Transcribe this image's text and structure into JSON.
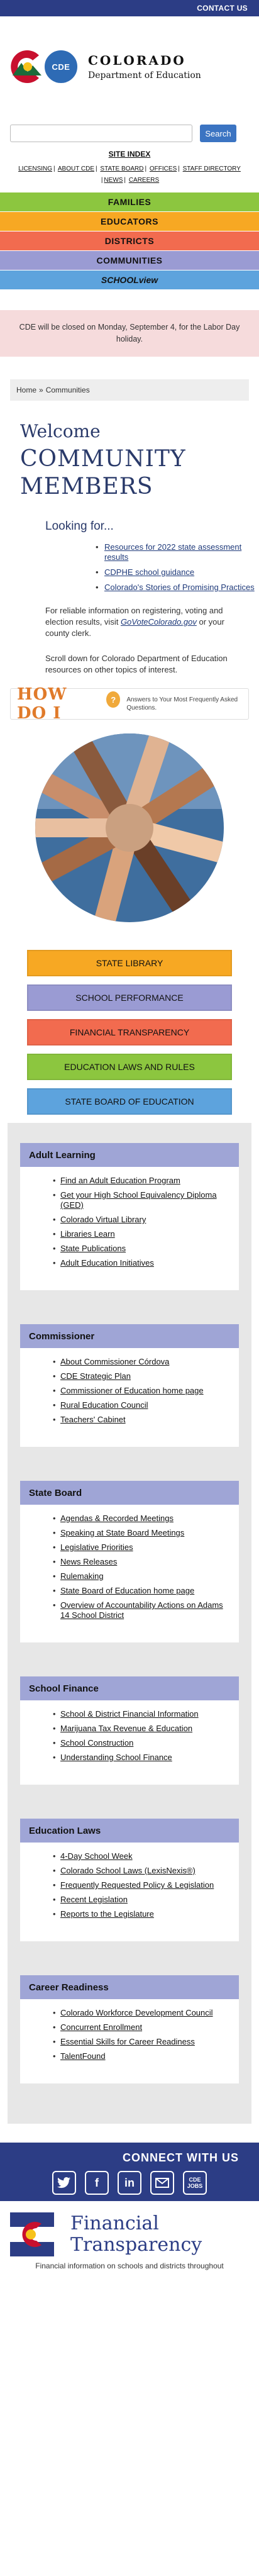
{
  "topbar": {
    "contact": "CONTACT US"
  },
  "brand": {
    "badge": "CDE",
    "name": "COLORADO",
    "sub": "Department of Education"
  },
  "search": {
    "placeholder": "",
    "button": "Search"
  },
  "site_index": "SITE INDEX",
  "utility_links": [
    "LICENSING",
    "ABOUT CDE",
    "STATE BOARD",
    "OFFICES",
    "STAFF DIRECTORY",
    "NEWS",
    "CAREERS"
  ],
  "nav": [
    {
      "label": "FAMILIES",
      "color": "#8cc63f"
    },
    {
      "label": "EDUCATORS",
      "color": "#f7a823"
    },
    {
      "label": "DISTRICTS",
      "color": "#f26b4f"
    },
    {
      "label": "COMMUNITIES",
      "color": "#9a9bd3"
    },
    {
      "label": "SCHOOLview",
      "color": "#5da3dd"
    }
  ],
  "alert": "CDE will be closed on Monday, September 4, for the Labor Day holiday.",
  "breadcrumb": {
    "home": "Home",
    "sep": "»",
    "current": "Communities"
  },
  "welcome": {
    "line1": "Welcome",
    "line2": "COMMUNITY MEMBERS"
  },
  "looking_for": {
    "title": "Looking for...",
    "items": [
      "Resources for 2022 state assessment results",
      "CDPHE school guidance",
      "Colorado's Stories of Promising Practices"
    ]
  },
  "para1": {
    "before": "For reliable information on registering, voting and election results, visit ",
    "link": "GoVoteColorado.gov",
    "after": " or your county clerk."
  },
  "para2": "Scroll down for Colorado Department of Education resources on other topics of interest.",
  "howdoi": {
    "title": "HOW DO I",
    "q": "?",
    "sub": "Answers to Your Most Frequently Asked Questions."
  },
  "quick_buttons": [
    {
      "label": "STATE LIBRARY",
      "color": "#f7a823"
    },
    {
      "label": "SCHOOL PERFORMANCE",
      "color": "#9a9bd3"
    },
    {
      "label": "FINANCIAL TRANSPARENCY",
      "color": "#f26b4f"
    },
    {
      "label": "EDUCATION LAWS AND RULES",
      "color": "#8cc63f"
    },
    {
      "label": "STATE BOARD OF EDUCATION",
      "color": "#5da3dd"
    }
  ],
  "cards": [
    {
      "title": "Adult Learning",
      "links": [
        "Find an Adult Education Program",
        "Get your High School Equivalency Diploma (GED)",
        "Colorado Virtual Library",
        "Libraries Learn",
        "State Publications",
        "Adult Education Initiatives"
      ]
    },
    {
      "title": "Commissioner",
      "links": [
        "About Commissioner Córdova",
        "CDE Strategic Plan",
        "Commissioner of Education home page",
        "Rural Education Council",
        "Teachers' Cabinet"
      ]
    },
    {
      "title": "State Board",
      "links": [
        "Agendas & Recorded Meetings",
        "Speaking at State Board Meetings",
        "Legislative Priorities",
        "News Releases",
        "Rulemaking",
        "State Board of Education home page",
        "Overview of Accountability Actions on Adams 14 School District"
      ]
    },
    {
      "title": "School Finance",
      "links": [
        "School & District Financial Information",
        "Marijuana Tax Revenue & Education",
        "School Construction",
        "Understanding School Finance"
      ]
    },
    {
      "title": "Education Laws",
      "links": [
        "4-Day School Week",
        "Colorado School Laws (LexisNexis®)",
        "Frequently Requested Policy & Legislation",
        "Recent Legislation",
        "Reports to the Legislature"
      ]
    },
    {
      "title": "Career Readiness",
      "links": [
        "Colorado Workforce Development Council",
        "Concurrent Enrollment",
        "Essential Skills for Career Readiness",
        "TalentFound"
      ]
    }
  ],
  "connect": {
    "title": "CONNECT WITH US",
    "cde": "CDE JOBS"
  },
  "fintrans": {
    "line1": "Financial",
    "line2": "Transparency",
    "foot": "Financial information on schools and districts throughout"
  }
}
